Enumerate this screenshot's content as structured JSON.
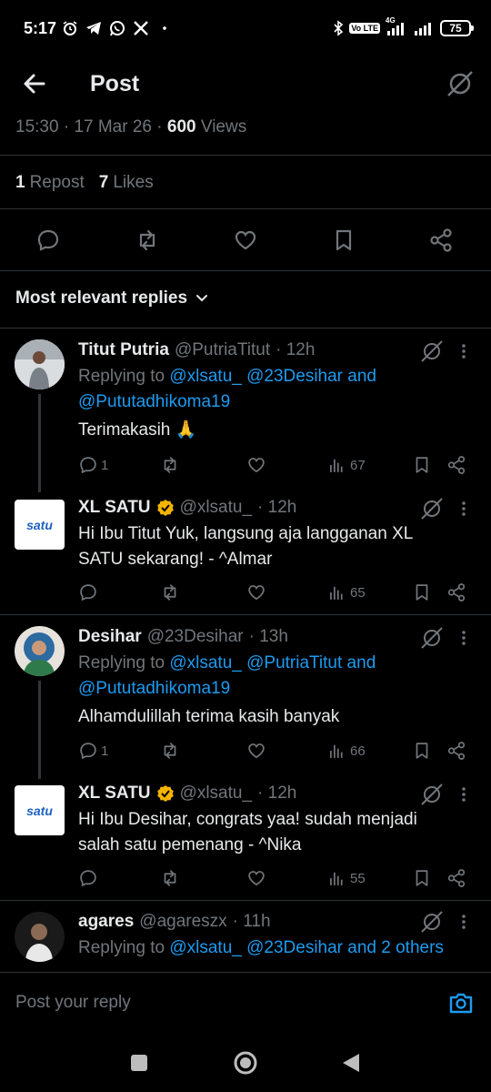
{
  "status_bar": {
    "time": "5:17",
    "lte_label": "Vo LTE",
    "network_label": "4G",
    "battery": "75"
  },
  "header": {
    "title": "Post"
  },
  "post_meta": {
    "time": "15:30",
    "date": "17 Mar 26",
    "views_count": "600",
    "views_label": "Views"
  },
  "engagement": {
    "reposts_count": "1",
    "reposts_label": "Repost",
    "likes_count": "7",
    "likes_label": "Likes"
  },
  "sort": {
    "label": "Most relevant replies"
  },
  "replies": [
    {
      "name": "Titut Putria",
      "handle": "@PutriaTitut",
      "time": "· 12h",
      "replying_prefix": "Replying to",
      "replying_links": "@xlsatu_ @23Desihar and",
      "replying_links2": "@Pututadhikoma19",
      "text": "Terimakasih 🙏",
      "reply_count": "1",
      "views": "67"
    },
    {
      "name": "XL SATU",
      "handle": "@xlsatu_",
      "time": "· 12h",
      "text_line1": "Hi Ibu Titut Yuk, langsung aja langganan XL",
      "text_line2": "SATU sekarang! - ^Almar",
      "reply_count": "",
      "views": "65",
      "avatar_text": "satu"
    },
    {
      "name": "Desihar",
      "handle": "@23Desihar",
      "time": "· 13h",
      "replying_prefix": "Replying to",
      "replying_links": "@xlsatu_ @PutriaTitut and",
      "replying_links2": "@Pututadhikoma19",
      "text": "Alhamdulillah terima kasih banyak",
      "reply_count": "1",
      "views": "66"
    },
    {
      "name": "XL SATU",
      "handle": "@xlsatu_",
      "time": "· 12h",
      "text_line1": "Hi Ibu Desihar, congrats yaa! sudah menjadi",
      "text_line2": "salah satu pemenang  - ^Nika",
      "reply_count": "",
      "views": "55",
      "avatar_text": "satu"
    },
    {
      "name": "agares",
      "handle": "@agareszx",
      "time": "· 11h",
      "replying_prefix": "Replying to",
      "replying_links": "@xlsatu_ @23Desihar and 2 others"
    }
  ],
  "compose": {
    "placeholder": "Post your reply"
  },
  "colors": {
    "background": "#000000",
    "link": "#1d9bf0",
    "muted": "#71767b",
    "text": "#e7e9ea",
    "verified": "#f4b400"
  }
}
